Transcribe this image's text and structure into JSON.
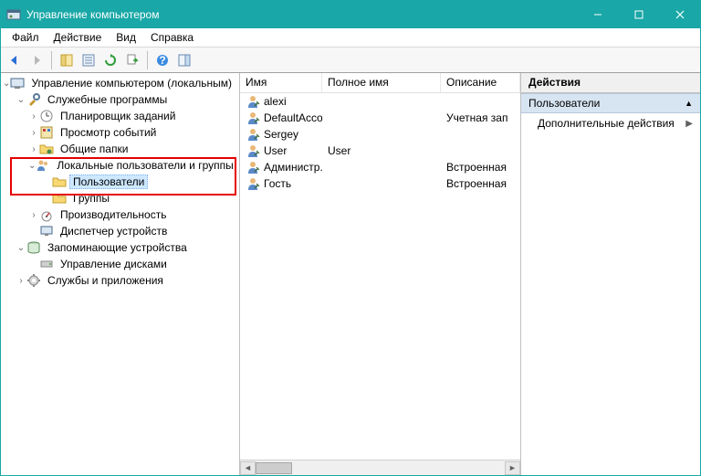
{
  "window": {
    "title": "Управление компьютером"
  },
  "menu": {
    "file": "Файл",
    "action": "Действие",
    "view": "Вид",
    "help": "Справка"
  },
  "tree": {
    "root": "Управление компьютером (локальным)",
    "system_tools": "Служебные программы",
    "task_scheduler": "Планировщик заданий",
    "event_viewer": "Просмотр событий",
    "shared_folders": "Общие папки",
    "local_users_groups": "Локальные пользователи и группы",
    "users": "Пользователи",
    "groups": "Группы",
    "performance": "Производительность",
    "device_manager": "Диспетчер устройств",
    "storage": "Запоминающие устройства",
    "disk_management": "Управление дисками",
    "services_apps": "Службы и приложения"
  },
  "columns": {
    "name": "Имя",
    "full_name": "Полное имя",
    "description": "Описание"
  },
  "users": [
    {
      "name": "alexi",
      "full_name": "",
      "description": ""
    },
    {
      "name": "DefaultAcco...",
      "full_name": "",
      "description": "Учетная зап"
    },
    {
      "name": "Sergey",
      "full_name": "",
      "description": ""
    },
    {
      "name": "User",
      "full_name": "User",
      "description": ""
    },
    {
      "name": "Администр...",
      "full_name": "",
      "description": "Встроенная"
    },
    {
      "name": "Гость",
      "full_name": "",
      "description": "Встроенная"
    }
  ],
  "actions": {
    "header": "Действия",
    "group": "Пользователи",
    "more": "Дополнительные действия"
  }
}
